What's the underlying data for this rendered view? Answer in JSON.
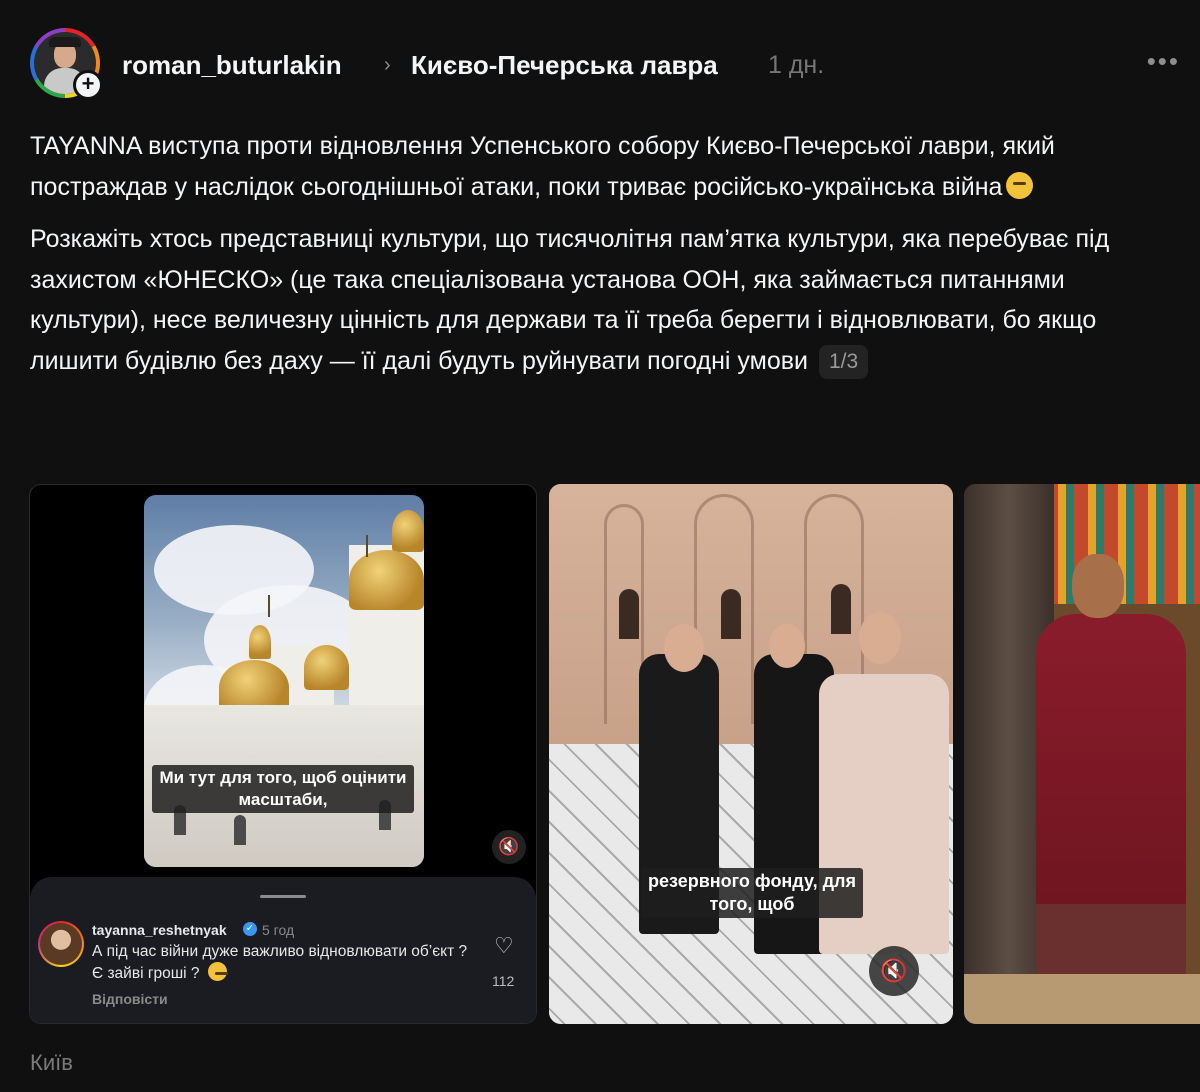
{
  "post": {
    "username": "roman_buturlakin",
    "location": "Києво-Печерська лавра",
    "time": "1 дн.",
    "caption_p1": "TAYANNA виступа проти відновлення Успенського собору Києво-Печерської лаври, який постраждав у наслідок сьогоднішньої атаки, поки триває російсько-українська війна",
    "caption_p2": "Розкажіть хтось представниці культури, що тисячолітня пам’ятка культури, яка перебуває під захистом «ЮНЕСКО» (це така спеціалізована установа ООН, яка займається питаннями культури), несе величезну цінність для держави та її треба берегти і відновлювати, бо якщо лишити будівлю без даху — її далі будуть руйнувати погодні умови",
    "counter": "1/3",
    "place": "Київ"
  },
  "media": {
    "slide1_subtitle": "Ми тут для того, щоб оцінити масштаби,",
    "slide2_subtitle": "резервного фонду, для того, щоб"
  },
  "comment": {
    "username": "tayanna_reshetnyak",
    "time": "5 год",
    "text": "А під час війни дуже важливо відновлювати об’єкт ? Є зайві гроші ?",
    "reply": "Відповісти",
    "likes": "112"
  },
  "icons": {
    "more": "more-horizontal-icon",
    "chevron": "chevron-right-icon",
    "mute": "speaker-muted-icon",
    "heart": "heart-outline-icon",
    "follow": "plus-icon"
  },
  "colors": {
    "background": "#101010",
    "text": "#f3f5f7",
    "muted": "#777777",
    "verified": "#3897f0"
  }
}
